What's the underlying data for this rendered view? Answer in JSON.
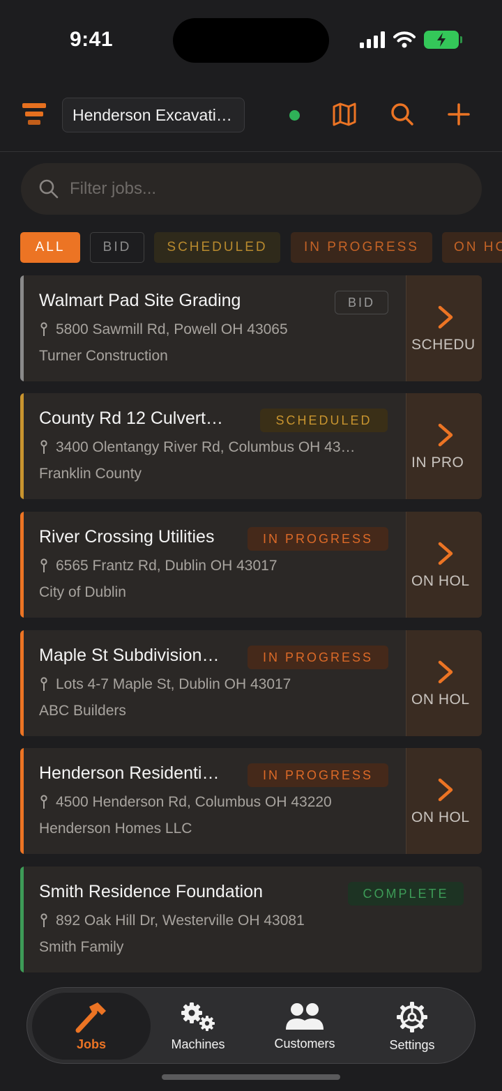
{
  "status_bar": {
    "time": "9:41"
  },
  "header": {
    "company": "Henderson Excavati…"
  },
  "filter": {
    "placeholder": "Filter jobs..."
  },
  "chips": [
    {
      "label": "ALL"
    },
    {
      "label": "BID"
    },
    {
      "label": "SCHEDULED"
    },
    {
      "label": "IN PROGRESS"
    },
    {
      "label": "ON HC"
    }
  ],
  "jobs": [
    {
      "title": "Walmart Pad Site Grading",
      "status": "BID",
      "address": "5800 Sawmill Rd, Powell OH 43065",
      "client": "Turner Construction",
      "next": "SCHEDU"
    },
    {
      "title": "County Rd 12 Culvert…",
      "status": "SCHEDULED",
      "address": "3400 Olentangy River Rd, Columbus OH 43…",
      "client": "Franklin County",
      "next": "IN PRO"
    },
    {
      "title": "River Crossing Utilities",
      "status": "IN PROGRESS",
      "address": "6565 Frantz Rd, Dublin OH 43017",
      "client": "City of Dublin",
      "next": "ON HOL"
    },
    {
      "title": "Maple St Subdivision…",
      "status": "IN PROGRESS",
      "address": "Lots 4-7 Maple St, Dublin OH 43017",
      "client": "ABC Builders",
      "next": "ON HOL"
    },
    {
      "title": "Henderson Residenti…",
      "status": "IN PROGRESS",
      "address": "4500 Henderson Rd, Columbus OH 43220",
      "client": "Henderson Homes LLC",
      "next": "ON HOL"
    },
    {
      "title": "Smith Residence Foundation",
      "status": "COMPLETE",
      "address": "892 Oak Hill Dr, Westerville OH 43081",
      "client": "Smith Family"
    }
  ],
  "tabs": [
    {
      "label": "Jobs",
      "icon": "hammer-icon"
    },
    {
      "label": "Machines",
      "icon": "gears-icon"
    },
    {
      "label": "Customers",
      "icon": "users-icon"
    },
    {
      "label": "Settings",
      "icon": "gear-icon"
    }
  ],
  "colors": {
    "accent": "#ec7424",
    "bid": "#8c8c8c",
    "scheduled": "#c8942f",
    "in_progress": "#dc6a28",
    "complete": "#3d9b57"
  }
}
